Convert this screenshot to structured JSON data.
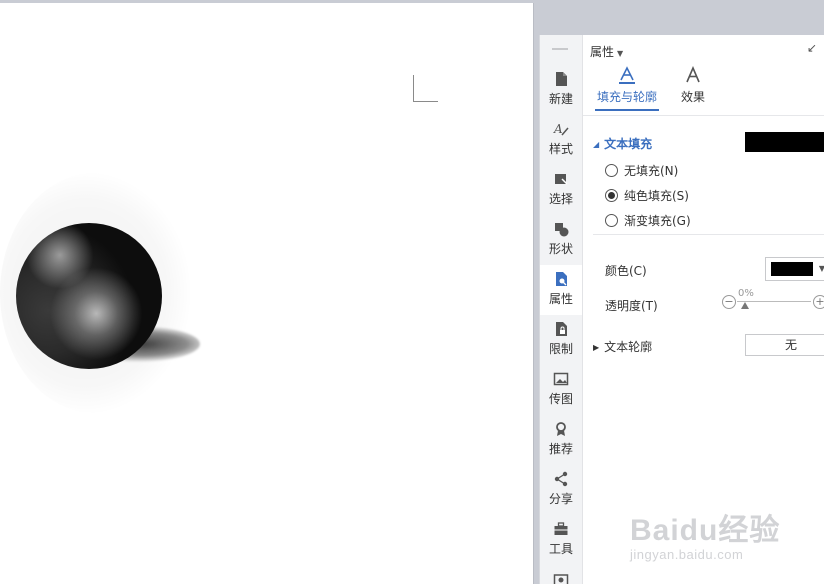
{
  "panel": {
    "header_title": "属性",
    "nav_items": [
      {
        "label": "新建",
        "icon": "new-doc-icon"
      },
      {
        "label": "样式",
        "icon": "style-icon"
      },
      {
        "label": "选择",
        "icon": "select-icon"
      },
      {
        "label": "形状",
        "icon": "shape-icon"
      },
      {
        "label": "属性",
        "icon": "properties-icon",
        "active": true
      },
      {
        "label": "限制",
        "icon": "restrict-icon"
      },
      {
        "label": "传图",
        "icon": "upload-image-icon"
      },
      {
        "label": "推荐",
        "icon": "recommend-icon"
      },
      {
        "label": "分享",
        "icon": "share-icon"
      },
      {
        "label": "工具",
        "icon": "toolbox-icon"
      }
    ],
    "tabs": [
      {
        "label": "填充与轮廓",
        "active": true
      },
      {
        "label": "效果",
        "active": false
      }
    ],
    "text_fill": {
      "title": "文本填充",
      "swatch_color": "#000000",
      "options": [
        {
          "label": "无填充(N)",
          "checked": false
        },
        {
          "label": "纯色填充(S)",
          "checked": true
        },
        {
          "label": "渐变填充(G)",
          "checked": false
        }
      ],
      "color_label": "颜色(C)",
      "color_value": "#000000",
      "opacity_label": "透明度(T)",
      "opacity_value": "0%"
    },
    "text_outline": {
      "title": "文本轮廓",
      "value": "无"
    }
  },
  "watermark": {
    "main": "Baidu经验",
    "sub": "jingyan.baidu.com"
  },
  "colors": {
    "accent": "#3b6fbf"
  }
}
